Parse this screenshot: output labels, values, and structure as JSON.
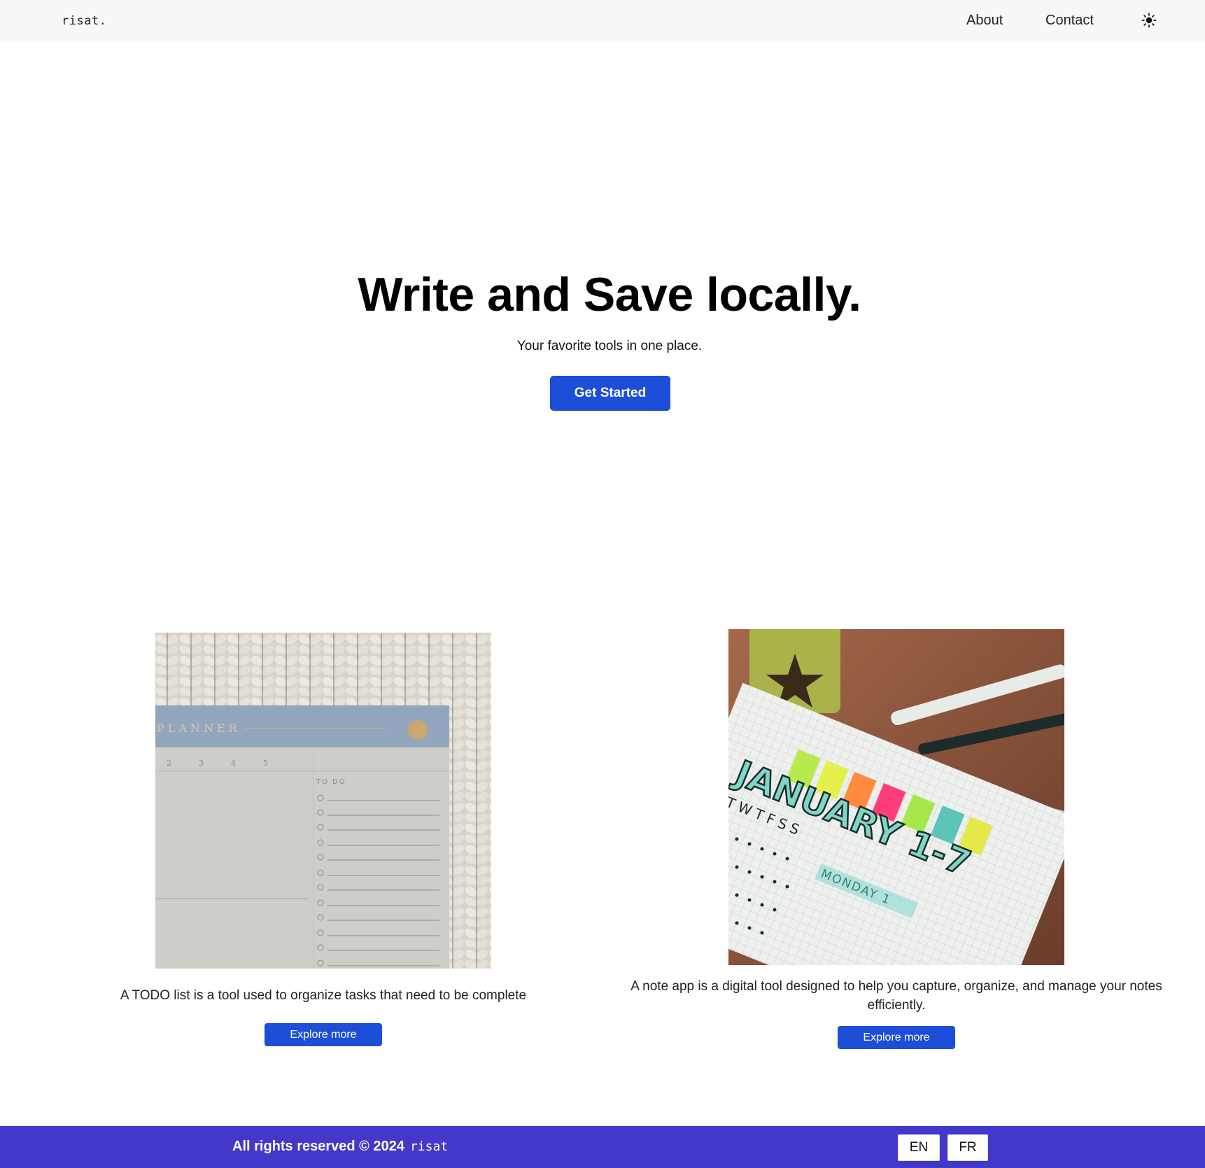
{
  "header": {
    "logo": "risat.",
    "nav": {
      "about": "About",
      "contact": "Contact"
    },
    "theme_icon": "sun-icon"
  },
  "hero": {
    "title": "Write and Save locally.",
    "subtitle": "Your favorite tools in one place.",
    "cta_label": "Get Started"
  },
  "cards": [
    {
      "image_text": {
        "planner": "PLANNER",
        "todo": "TO DO",
        "days": [
          "2",
          "3",
          "4",
          "5"
        ]
      },
      "description": "A TODO list is a tool used to organize tasks that need to be complete",
      "button_label": "Explore more"
    },
    {
      "image_text": {
        "title": "JANUARY 1-7",
        "weekdays": "TWTFSS",
        "day": "MONDAY 1"
      },
      "description": "A note app is a digital tool designed to help you capture, organize, and manage your notes efficiently.",
      "button_label": "Explore more"
    }
  ],
  "footer": {
    "copyright": "All rights reserved © 2024",
    "brand": "risat",
    "languages": [
      "EN",
      "FR"
    ]
  },
  "colors": {
    "primary": "#1d4ed8",
    "footer_bg": "#4338ca",
    "header_bg": "#f8f8f8"
  }
}
